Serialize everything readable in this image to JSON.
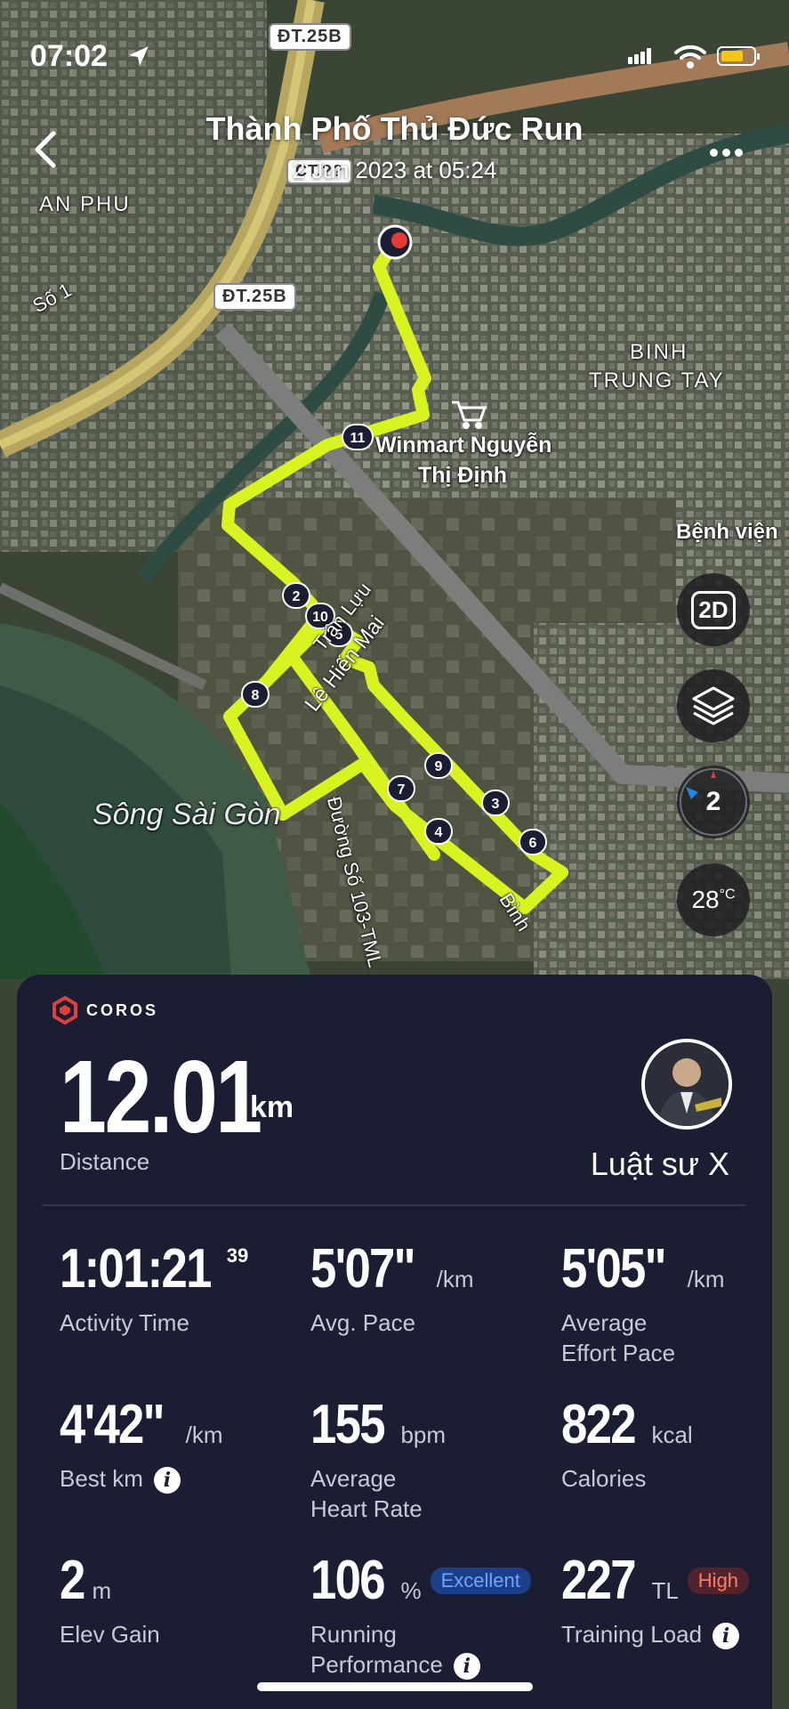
{
  "status_bar": {
    "time": "07:02"
  },
  "header": {
    "title": "Thành Phố Thủ Đức Run",
    "subtitle": "2 Jun 2023 at 05:24"
  },
  "map": {
    "labels": {
      "an_phu": "AN PHU",
      "so1": "Số 1",
      "binh_trung_tay": [
        "BINH",
        "TRUNG TAY"
      ],
      "winmart": [
        "Winmart Nguyễn",
        "Thị Định"
      ],
      "benh_vien": "Bệnh viện",
      "song_sai_gon": "Sông Sài Gòn",
      "duong_so": "Đường Số 103-TML",
      "le_hien_mai": "Lê Hiến Mai",
      "tran_luu": "Trần Lựu",
      "street_binh": "Bình"
    },
    "road_tags": [
      "ĐT.25B",
      "ĐT.25B",
      "CT.??"
    ],
    "markers": [
      "2",
      "10",
      "5",
      "8",
      "11",
      "9",
      "7",
      "3",
      "4",
      "6"
    ],
    "buttons": {
      "view_2d": "2D",
      "compass": "2",
      "temperature": "28",
      "temperature_unit": "°C"
    }
  },
  "card": {
    "brand": "COROS",
    "distance": {
      "value": "12.01",
      "unit": "km",
      "label": "Distance"
    },
    "user": {
      "name": "Luật sư X"
    },
    "stats": [
      {
        "value": "1:01:21",
        "sup": "39",
        "label": "Activity Time"
      },
      {
        "value": "5'07\"",
        "unit": "/km",
        "label": "Avg. Pace"
      },
      {
        "value": "5'05\"",
        "unit": "/km",
        "label": [
          "Average",
          "Effort Pace"
        ]
      },
      {
        "value": "4'42\"",
        "unit": "/km",
        "label": "Best km"
      },
      {
        "value": "155",
        "unit": "bpm",
        "label": [
          "Average",
          "Heart Rate"
        ]
      },
      {
        "value": "822",
        "unit": "kcal",
        "label": "Calories"
      },
      {
        "value": "2",
        "unit": "m",
        "label": "Elev Gain"
      },
      {
        "value": "106",
        "unit": "%",
        "badge": "Excellent",
        "label": [
          "Running",
          "Performance"
        ]
      },
      {
        "value": "227",
        "unit": "TL",
        "badge": "High",
        "label": "Training Load"
      }
    ]
  },
  "colors": {
    "route": "#d9f321",
    "card_bg": "#1b1d33",
    "battery": "#f4c51a",
    "coros_red": "#e0403a"
  }
}
